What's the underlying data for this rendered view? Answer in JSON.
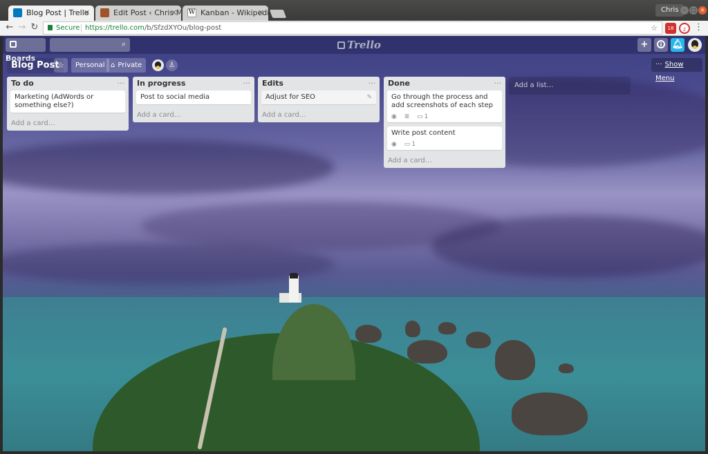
{
  "browser": {
    "tabs": [
      {
        "title": "Blog Post | Trello",
        "favicon_color": "#0079bf"
      },
      {
        "title": "Edit Post ‹ Chris Me",
        "favicon_color": "#a0522d"
      },
      {
        "title": "Kanban - Wikipedia",
        "favicon_color": "#ffffff"
      }
    ],
    "profile": "Chris",
    "secure_label": "Secure",
    "url_scheme": "https://",
    "url_host": "trello.com",
    "url_path": "/b/SfzdXYOu/blog-post",
    "extensions": [
      {
        "name": "todoist-extension",
        "badge": "18",
        "color": "#d0312d"
      },
      {
        "name": "adblock-extension",
        "badge": "2",
        "color": "#d0312d"
      }
    ]
  },
  "header": {
    "boards_label": "Boards",
    "logo_text": "Trello",
    "add_symbol": "+",
    "info_symbol": "i",
    "notify_color": "#29b6e8"
  },
  "board": {
    "title": "Blog Post",
    "team_label": "Personal",
    "visibility_label": "Private",
    "show_menu_label": "Show Menu",
    "add_list_label": "Add a list…"
  },
  "lists": [
    {
      "name": "To do",
      "add_card": "Add a card…",
      "cards": [
        {
          "text": "Marketing (AdWords or something else?)"
        }
      ]
    },
    {
      "name": "In progress",
      "add_card": "Add a card…",
      "cards": [
        {
          "text": "Post to social media"
        }
      ]
    },
    {
      "name": "Edits",
      "add_card": "Add a card…",
      "cards": [
        {
          "text": "Adjust for SEO"
        }
      ]
    },
    {
      "name": "Done",
      "add_card": "Add a card…",
      "cards": [
        {
          "text": "Go through the process and add screenshots of each step",
          "comments": "1"
        },
        {
          "text": "Write post content",
          "comments": "1"
        }
      ]
    }
  ]
}
